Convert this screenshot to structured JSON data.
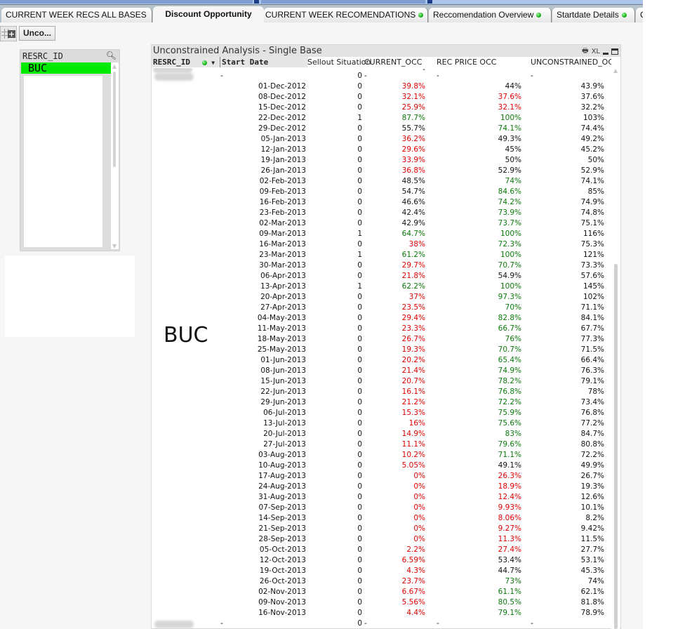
{
  "tabs": [
    {
      "label": "CURRENT WEEK RECS ALL BASES",
      "active": false,
      "status_dot": false
    },
    {
      "label": "Discount Opportunity",
      "active": true,
      "status_dot": false
    },
    {
      "label": "CURRENT WEEK RECOMENDATIONS",
      "active": false,
      "status_dot": true
    },
    {
      "label": "Reccomendation Overview",
      "active": false,
      "status_dot": true
    },
    {
      "label": "Startdate Details",
      "active": false,
      "status_dot": true
    },
    {
      "label": "C",
      "active": false,
      "status_dot": false
    }
  ],
  "minimized_object": {
    "label": "Unco..."
  },
  "listbox": {
    "title": "RESRC_ID",
    "selected": "BUC"
  },
  "big_label": "BUC",
  "table": {
    "title": "Unconstrained Analysis - Single Base",
    "caption_icons": [
      "print-icon",
      "XL",
      "minimize-icon",
      "maximize-icon"
    ],
    "xl_label": "XL",
    "headers": {
      "resrc_id": "RESRC_ID",
      "start_date": "Start Date",
      "sellout": "Sellout Situation",
      "current_occ": "CURRENT_OCC",
      "rec_price_occ": "REC PRICE OCC",
      "unconstrained_occ": "UNCONSTRAINED_OCC"
    },
    "colors": {
      "red": "#e00000",
      "green": "#0a7a0a",
      "black": "#111111",
      "selected": "#00e900"
    },
    "top_total": {
      "start_date": "-",
      "sellout": "0",
      "current_occ": "-",
      "rec_price_occ": "-",
      "unconstrained_occ": "-"
    },
    "bottom_total": {
      "start_date": "-",
      "sellout": "0",
      "current_occ": "-",
      "rec_price_occ": "-",
      "unconstrained_occ": "-"
    },
    "rows": [
      {
        "date": "01-Dec-2012",
        "sellout": "0",
        "cur": "39.8%",
        "cur_c": "red",
        "rec": "44%",
        "rec_c": "black",
        "unc": "43.9%"
      },
      {
        "date": "08-Dec-2012",
        "sellout": "0",
        "cur": "32.1%",
        "cur_c": "red",
        "rec": "37.6%",
        "rec_c": "red",
        "unc": "37.6%"
      },
      {
        "date": "15-Dec-2012",
        "sellout": "0",
        "cur": "25.9%",
        "cur_c": "red",
        "rec": "32.1%",
        "rec_c": "red",
        "unc": "32.2%"
      },
      {
        "date": "22-Dec-2012",
        "sellout": "1",
        "cur": "87.7%",
        "cur_c": "green",
        "rec": "100%",
        "rec_c": "green",
        "unc": "103%"
      },
      {
        "date": "29-Dec-2012",
        "sellout": "0",
        "cur": "55.7%",
        "cur_c": "black",
        "rec": "74.1%",
        "rec_c": "green",
        "unc": "74.4%"
      },
      {
        "date": "05-Jan-2013",
        "sellout": "0",
        "cur": "36.2%",
        "cur_c": "red",
        "rec": "49.3%",
        "rec_c": "black",
        "unc": "49.2%"
      },
      {
        "date": "12-Jan-2013",
        "sellout": "0",
        "cur": "29.6%",
        "cur_c": "red",
        "rec": "45%",
        "rec_c": "black",
        "unc": "45.2%"
      },
      {
        "date": "19-Jan-2013",
        "sellout": "0",
        "cur": "33.9%",
        "cur_c": "red",
        "rec": "50%",
        "rec_c": "black",
        "unc": "50%"
      },
      {
        "date": "26-Jan-2013",
        "sellout": "0",
        "cur": "36.8%",
        "cur_c": "red",
        "rec": "52.9%",
        "rec_c": "black",
        "unc": "52.9%"
      },
      {
        "date": "02-Feb-2013",
        "sellout": "0",
        "cur": "48.5%",
        "cur_c": "black",
        "rec": "74%",
        "rec_c": "green",
        "unc": "74.1%"
      },
      {
        "date": "09-Feb-2013",
        "sellout": "0",
        "cur": "54.7%",
        "cur_c": "black",
        "rec": "84.6%",
        "rec_c": "green",
        "unc": "85%"
      },
      {
        "date": "16-Feb-2013",
        "sellout": "0",
        "cur": "46.6%",
        "cur_c": "black",
        "rec": "74.2%",
        "rec_c": "green",
        "unc": "74.9%"
      },
      {
        "date": "23-Feb-2013",
        "sellout": "0",
        "cur": "42.4%",
        "cur_c": "black",
        "rec": "73.9%",
        "rec_c": "green",
        "unc": "74.8%"
      },
      {
        "date": "02-Mar-2013",
        "sellout": "0",
        "cur": "42.9%",
        "cur_c": "black",
        "rec": "73.7%",
        "rec_c": "green",
        "unc": "75.1%"
      },
      {
        "date": "09-Mar-2013",
        "sellout": "1",
        "cur": "64.7%",
        "cur_c": "green",
        "rec": "100%",
        "rec_c": "green",
        "unc": "116%"
      },
      {
        "date": "16-Mar-2013",
        "sellout": "0",
        "cur": "38%",
        "cur_c": "red",
        "rec": "72.3%",
        "rec_c": "green",
        "unc": "75.3%"
      },
      {
        "date": "23-Mar-2013",
        "sellout": "1",
        "cur": "61.2%",
        "cur_c": "green",
        "rec": "100%",
        "rec_c": "green",
        "unc": "121%"
      },
      {
        "date": "30-Mar-2013",
        "sellout": "0",
        "cur": "29.7%",
        "cur_c": "red",
        "rec": "70.7%",
        "rec_c": "green",
        "unc": "73.3%"
      },
      {
        "date": "06-Apr-2013",
        "sellout": "0",
        "cur": "21.8%",
        "cur_c": "red",
        "rec": "54.9%",
        "rec_c": "black",
        "unc": "57.6%"
      },
      {
        "date": "13-Apr-2013",
        "sellout": "1",
        "cur": "62.2%",
        "cur_c": "green",
        "rec": "100%",
        "rec_c": "green",
        "unc": "145%"
      },
      {
        "date": "20-Apr-2013",
        "sellout": "0",
        "cur": "37%",
        "cur_c": "red",
        "rec": "97.3%",
        "rec_c": "green",
        "unc": "102%"
      },
      {
        "date": "27-Apr-2013",
        "sellout": "0",
        "cur": "23.5%",
        "cur_c": "red",
        "rec": "70%",
        "rec_c": "green",
        "unc": "71.1%"
      },
      {
        "date": "04-May-2013",
        "sellout": "0",
        "cur": "29.4%",
        "cur_c": "red",
        "rec": "82.8%",
        "rec_c": "green",
        "unc": "84.1%"
      },
      {
        "date": "11-May-2013",
        "sellout": "0",
        "cur": "23.3%",
        "cur_c": "red",
        "rec": "66.7%",
        "rec_c": "green",
        "unc": "67.7%"
      },
      {
        "date": "18-May-2013",
        "sellout": "0",
        "cur": "26.7%",
        "cur_c": "red",
        "rec": "76%",
        "rec_c": "green",
        "unc": "77.3%"
      },
      {
        "date": "25-May-2013",
        "sellout": "0",
        "cur": "19.3%",
        "cur_c": "red",
        "rec": "70.7%",
        "rec_c": "green",
        "unc": "71.5%"
      },
      {
        "date": "01-Jun-2013",
        "sellout": "0",
        "cur": "20.2%",
        "cur_c": "red",
        "rec": "65.4%",
        "rec_c": "green",
        "unc": "66.4%"
      },
      {
        "date": "08-Jun-2013",
        "sellout": "0",
        "cur": "21.4%",
        "cur_c": "red",
        "rec": "74.9%",
        "rec_c": "green",
        "unc": "76.3%"
      },
      {
        "date": "15-Jun-2013",
        "sellout": "0",
        "cur": "20.7%",
        "cur_c": "red",
        "rec": "78.2%",
        "rec_c": "green",
        "unc": "79.1%"
      },
      {
        "date": "22-Jun-2013",
        "sellout": "0",
        "cur": "16.1%",
        "cur_c": "red",
        "rec": "76.8%",
        "rec_c": "green",
        "unc": "78%"
      },
      {
        "date": "29-Jun-2013",
        "sellout": "0",
        "cur": "21.2%",
        "cur_c": "red",
        "rec": "72.2%",
        "rec_c": "green",
        "unc": "73.4%"
      },
      {
        "date": "06-Jul-2013",
        "sellout": "0",
        "cur": "15.3%",
        "cur_c": "red",
        "rec": "75.9%",
        "rec_c": "green",
        "unc": "76.8%"
      },
      {
        "date": "13-Jul-2013",
        "sellout": "0",
        "cur": "16%",
        "cur_c": "red",
        "rec": "75.6%",
        "rec_c": "green",
        "unc": "77.2%"
      },
      {
        "date": "20-Jul-2013",
        "sellout": "0",
        "cur": "14.9%",
        "cur_c": "red",
        "rec": "83%",
        "rec_c": "green",
        "unc": "84.7%"
      },
      {
        "date": "27-Jul-2013",
        "sellout": "0",
        "cur": "11.1%",
        "cur_c": "red",
        "rec": "79.6%",
        "rec_c": "green",
        "unc": "80.8%"
      },
      {
        "date": "03-Aug-2013",
        "sellout": "0",
        "cur": "10.2%",
        "cur_c": "red",
        "rec": "71.1%",
        "rec_c": "green",
        "unc": "72.2%"
      },
      {
        "date": "10-Aug-2013",
        "sellout": "0",
        "cur": "5.05%",
        "cur_c": "red",
        "rec": "49.1%",
        "rec_c": "black",
        "unc": "49.9%"
      },
      {
        "date": "17-Aug-2013",
        "sellout": "0",
        "cur": "0%",
        "cur_c": "red",
        "rec": "26.3%",
        "rec_c": "red",
        "unc": "26.7%"
      },
      {
        "date": "24-Aug-2013",
        "sellout": "0",
        "cur": "0%",
        "cur_c": "red",
        "rec": "18.9%",
        "rec_c": "red",
        "unc": "19.3%"
      },
      {
        "date": "31-Aug-2013",
        "sellout": "0",
        "cur": "0%",
        "cur_c": "red",
        "rec": "12.4%",
        "rec_c": "red",
        "unc": "12.6%"
      },
      {
        "date": "07-Sep-2013",
        "sellout": "0",
        "cur": "0%",
        "cur_c": "red",
        "rec": "9.93%",
        "rec_c": "red",
        "unc": "10.1%"
      },
      {
        "date": "14-Sep-2013",
        "sellout": "0",
        "cur": "0%",
        "cur_c": "red",
        "rec": "8.06%",
        "rec_c": "red",
        "unc": "8.2%"
      },
      {
        "date": "21-Sep-2013",
        "sellout": "0",
        "cur": "0%",
        "cur_c": "red",
        "rec": "9.27%",
        "rec_c": "red",
        "unc": "9.42%"
      },
      {
        "date": "28-Sep-2013",
        "sellout": "0",
        "cur": "0%",
        "cur_c": "red",
        "rec": "11.3%",
        "rec_c": "red",
        "unc": "11.5%"
      },
      {
        "date": "05-Oct-2013",
        "sellout": "0",
        "cur": "2.2%",
        "cur_c": "red",
        "rec": "27.4%",
        "rec_c": "red",
        "unc": "27.7%"
      },
      {
        "date": "12-Oct-2013",
        "sellout": "0",
        "cur": "6.59%",
        "cur_c": "red",
        "rec": "53.4%",
        "rec_c": "black",
        "unc": "53.1%"
      },
      {
        "date": "19-Oct-2013",
        "sellout": "0",
        "cur": "4.3%",
        "cur_c": "red",
        "rec": "44.7%",
        "rec_c": "black",
        "unc": "45.3%"
      },
      {
        "date": "26-Oct-2013",
        "sellout": "0",
        "cur": "23.7%",
        "cur_c": "red",
        "rec": "73%",
        "rec_c": "green",
        "unc": "74%"
      },
      {
        "date": "02-Nov-2013",
        "sellout": "0",
        "cur": "6.67%",
        "cur_c": "red",
        "rec": "61.1%",
        "rec_c": "green",
        "unc": "62.1%"
      },
      {
        "date": "09-Nov-2013",
        "sellout": "0",
        "cur": "5.56%",
        "cur_c": "red",
        "rec": "80.5%",
        "rec_c": "green",
        "unc": "81.8%"
      },
      {
        "date": "16-Nov-2013",
        "sellout": "0",
        "cur": "4.4%",
        "cur_c": "red",
        "rec": "79.1%",
        "rec_c": "green",
        "unc": "78.9%"
      }
    ]
  }
}
